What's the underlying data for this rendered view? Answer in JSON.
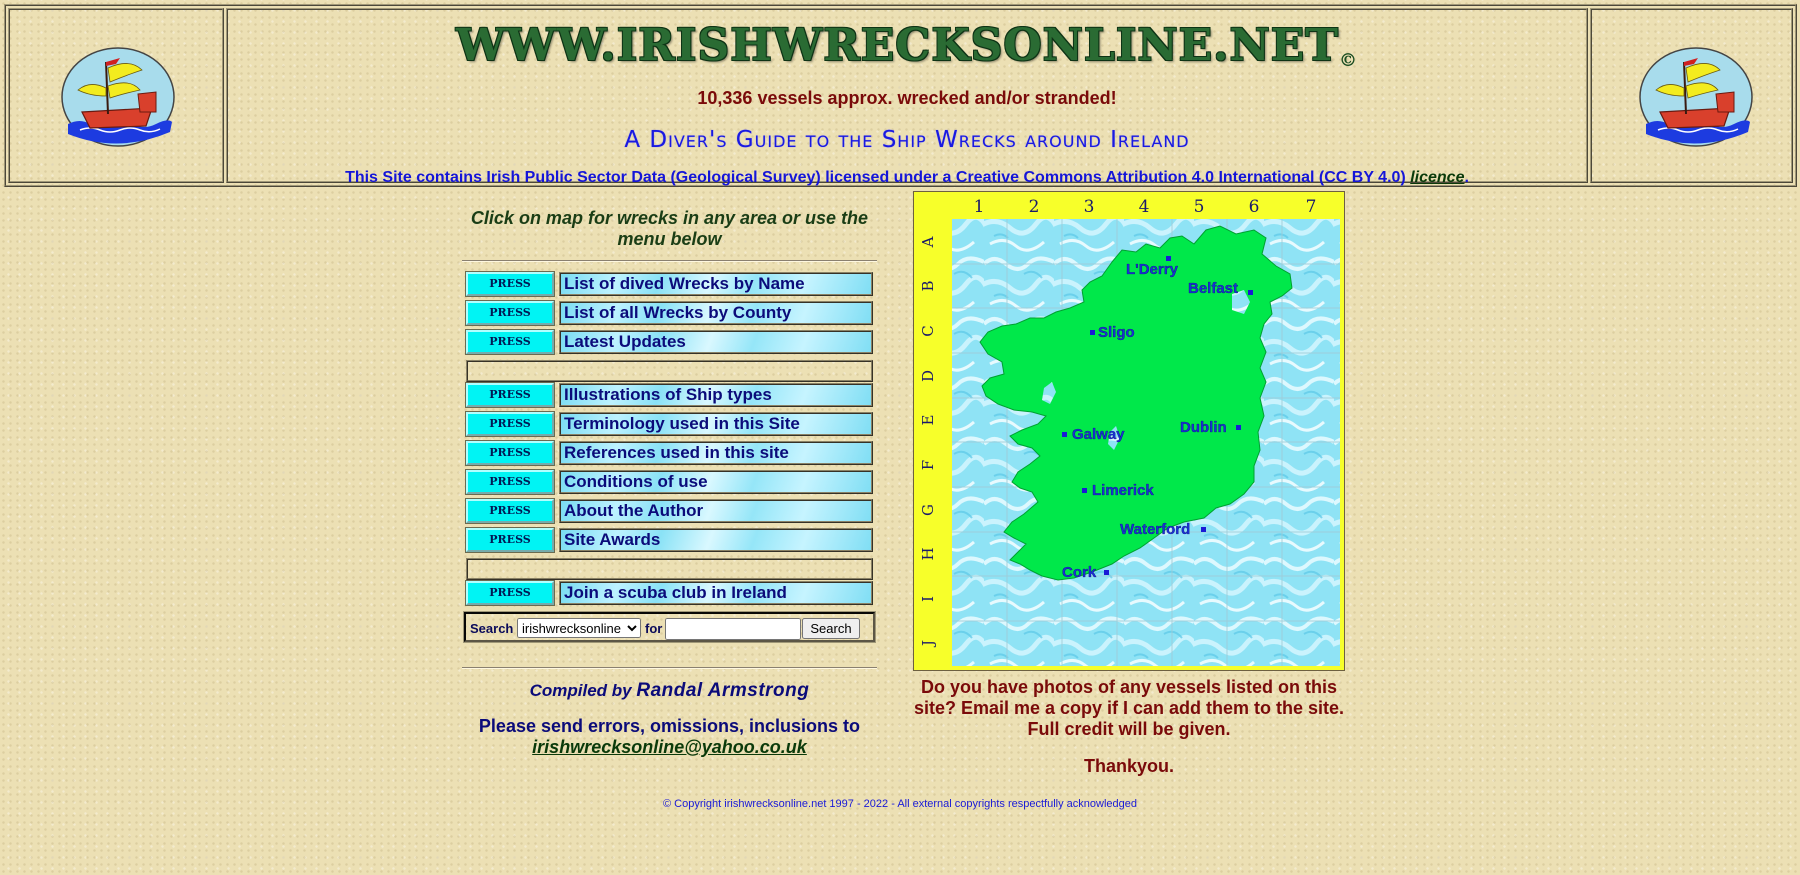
{
  "header": {
    "site_title": "WWW.IRISHWRECKSONLINE.NET",
    "copyright_mark": "©",
    "vessels_count": "10,336 vessels approx. wrecked and/or stranded!",
    "subtitle": "A Diver's Guide to the Ship Wrecks around Ireland",
    "license_text": "This Site contains Irish Public Sector Data (Geological Survey) licensed under a Creative Commons Attribution 4.0 International (CC BY 4.0)",
    "license_link": "licence",
    "license_end": "."
  },
  "intro": {
    "click_hint": "Click on map for wrecks in any area or use the menu below"
  },
  "menu": {
    "press_label": "PRESS",
    "items_top": [
      "List of dived Wrecks by Name",
      "List of all Wrecks by County",
      "Latest Updates"
    ],
    "items_mid": [
      "Illustrations of Ship types",
      "Terminology used in this Site",
      "References used in this site",
      "Conditions of use",
      "About the Author",
      "Site Awards"
    ],
    "items_bottom": [
      "Join a scuba club in Ireland"
    ]
  },
  "search": {
    "label": "Search",
    "scope_selected": "irishwrecksonline",
    "for_label": "for",
    "query": "",
    "button": "Search"
  },
  "credits": {
    "compiled_by": "Compiled by",
    "author": "Randal Armstrong",
    "send_text": "Please send errors, omissions, inclusions to",
    "email": "irishwrecksonline@yahoo.co.uk"
  },
  "map": {
    "columns": [
      "1",
      "2",
      "3",
      "4",
      "5",
      "6",
      "7"
    ],
    "rows": [
      "A",
      "B",
      "C",
      "D",
      "E",
      "F",
      "G",
      "H",
      "I",
      "J"
    ],
    "cities": [
      "L'Derry",
      "Belfast",
      "Sligo",
      "Galway",
      "Dublin",
      "Limerick",
      "Waterford",
      "Cork"
    ],
    "land_color": "#00e84a",
    "sea_color": "#8fe3f5",
    "border_color": "#f7ff2a"
  },
  "photos": {
    "request": "Do you have photos of any vessels listed on this site? Email me a copy if I can add them to the site. Full credit will be given.",
    "thanks": "Thankyou."
  },
  "footer": {
    "copyright": "© Copyright irishwrecksonline.net 1997 - 2022 - All external copyrights respectfully acknowledged"
  }
}
